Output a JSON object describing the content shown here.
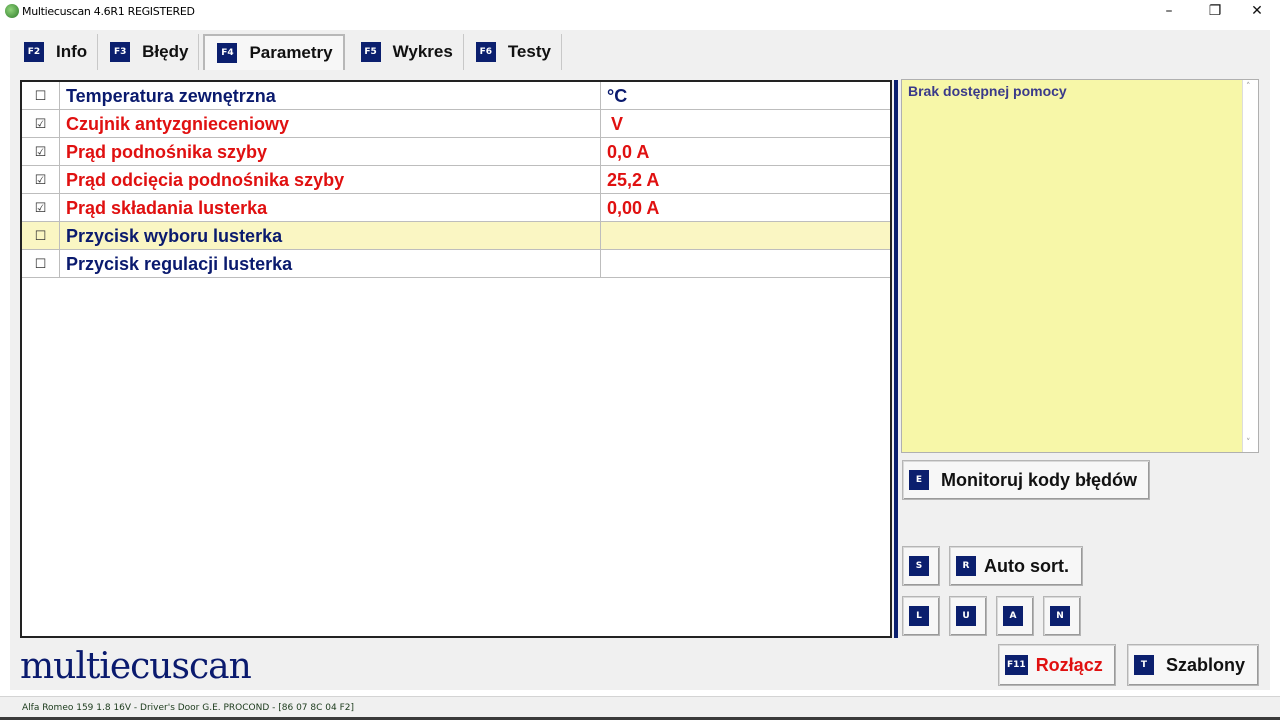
{
  "window": {
    "title": "Multiecuscan 4.6R1 REGISTERED",
    "min_glyph": "–",
    "max_glyph": "❐",
    "close_glyph": "✕"
  },
  "tabs": [
    {
      "key": "F2",
      "label": "Info"
    },
    {
      "key": "F3",
      "label": "Błędy"
    },
    {
      "key": "F4",
      "label": "Parametry"
    },
    {
      "key": "F5",
      "label": "Wykres"
    },
    {
      "key": "F6",
      "label": "Testy"
    }
  ],
  "active_tab": "Parametry",
  "parameters": [
    {
      "checked": false,
      "check_glyph": "☐",
      "name": "Temperatura zewnętrzna",
      "value": "°C",
      "color": "#0a1a6e"
    },
    {
      "checked": true,
      "check_glyph": "☑",
      "name": "Czujnik antyzgnieceniowy",
      "value": "V",
      "color": "#e01010"
    },
    {
      "checked": true,
      "check_glyph": "☑",
      "name": "Prąd podnośnika szyby",
      "value": "0,0 A",
      "color": "#e01010"
    },
    {
      "checked": true,
      "check_glyph": "☑",
      "name": "Prąd odcięcia podnośnika szyby",
      "value": "25,2 A",
      "color": "#e01010"
    },
    {
      "checked": true,
      "check_glyph": "☑",
      "name": "Prąd składania lusterka",
      "value": "0,00 A",
      "color": "#e01010"
    },
    {
      "checked": false,
      "check_glyph": "☐",
      "name": "Przycisk wyboru lusterka",
      "value": "",
      "color": "#0a1a6e",
      "highlighted": true
    },
    {
      "checked": false,
      "check_glyph": "☐",
      "name": "Przycisk regulacji lusterka",
      "value": "",
      "color": "#0a1a6e"
    }
  ],
  "help": {
    "text": "Brak dostępnej pomocy",
    "scroll_up": "˄",
    "scroll_down": "˅"
  },
  "buttons": {
    "monitor": {
      "key": "E",
      "label": "Monitoruj kody błędów"
    },
    "s": {
      "key": "S"
    },
    "auto_sort": {
      "key": "R",
      "label": "Auto sort."
    },
    "l": {
      "key": "L"
    },
    "u": {
      "key": "U"
    },
    "a": {
      "key": "A"
    },
    "n": {
      "key": "N"
    },
    "disconnect": {
      "key": "F11",
      "label": "Rozłącz"
    },
    "templates": {
      "key": "T",
      "label": "Szablony"
    }
  },
  "logo": "multiecuscan",
  "status": "Alfa Romeo 159 1.8 16V - Driver's Door G.E. PROCOND - [86 07 8C 04 F2]"
}
